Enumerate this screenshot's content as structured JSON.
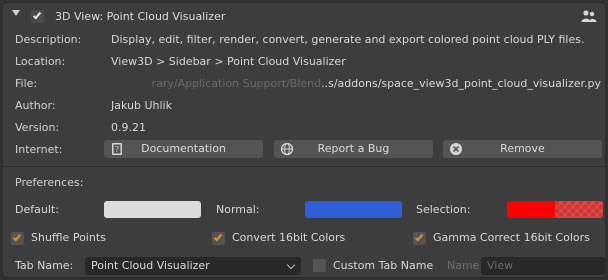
{
  "header": {
    "title": "3D View: Point Cloud Visualizer",
    "enabled": true
  },
  "info": {
    "description_label": "Description:",
    "description": "Display, edit, filter, render, convert, generate and export colored point cloud PLY files.",
    "location_label": "Location:",
    "location": "View3D > Sidebar > Point Cloud Visualizer",
    "file_label": "File:",
    "file_faded": "rary/Application Support/Blend",
    "file": "..s/addons/space_view3d_point_cloud_visualizer.py",
    "author_label": "Author:",
    "author": "Jakub Uhlik",
    "version_label": "Version:",
    "version": "0.9.21",
    "internet_label": "Internet:"
  },
  "buttons": {
    "documentation": "Documentation",
    "report_bug": "Report a Bug",
    "remove": "Remove"
  },
  "preferences": {
    "title": "Preferences:",
    "default_label": "Default:",
    "normal_label": "Normal:",
    "selection_label": "Selection:",
    "default_color": "#dcdcdc",
    "normal_color": "#2d5fd6",
    "selection_color": "#ff0000",
    "shuffle_points": "Shuffle Points",
    "convert_16bit": "Convert 16bit Colors",
    "gamma_correct": "Gamma Correct 16bit Colors",
    "tab_name_label": "Tab Name:",
    "tab_name_value": "Point Cloud Visualizer",
    "custom_tab_label": "Custom Tab Name",
    "name_label": "Name:",
    "name_placeholder": "View"
  }
}
